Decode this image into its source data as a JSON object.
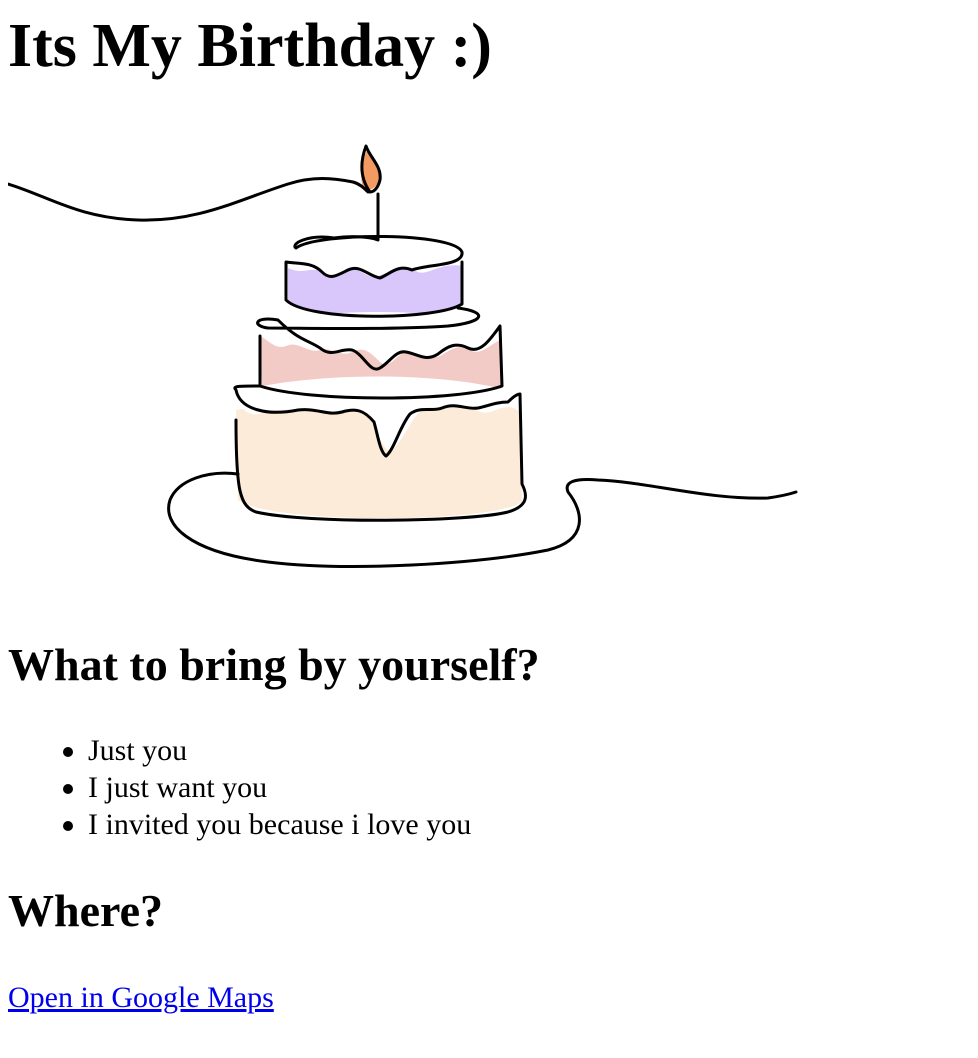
{
  "page": {
    "title": "Its My Birthday :)"
  },
  "illustration": {
    "icon": "birthday-cake-illustration",
    "colors": {
      "flame": "#F29A62",
      "top_tier": "#D9C6FA",
      "middle_tier": "#F2CBC7",
      "bottom_tier": "#FCEBD8",
      "line": "#000000"
    }
  },
  "bring_section": {
    "heading": "What to bring by yourself?",
    "items": [
      "Just you",
      "I just want you",
      "I invited you because i love you"
    ]
  },
  "where_section": {
    "heading": "Where?",
    "link_label": "Open in Google Maps",
    "link_color": "#0000EE"
  }
}
